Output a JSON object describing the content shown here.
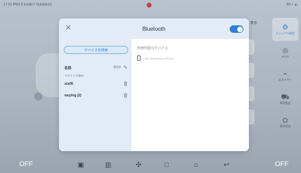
{
  "statusbar": {
    "left": "17:01 PM2.5 Inside7 Outside19",
    "right": "4G • ▲"
  },
  "background": {
    "right_top_text": "表示"
  },
  "side_nav": [
    {
      "label": "ビジュアル設定",
      "icon": "gear-icon",
      "active": true
    },
    {
      "label": "ADAS",
      "icon": "steering-icon",
      "active": false
    },
    {
      "label": "エネルギー",
      "icon": "energy-icon",
      "active": false
    },
    {
      "label": "車両設定",
      "icon": "car-icon",
      "active": false
    },
    {
      "label": "車両状況",
      "icon": "car-status-icon",
      "active": false
    }
  ],
  "bottombar": {
    "left_off": "OFF",
    "right_off": "OFF"
  },
  "modal": {
    "title": "Bluetooth",
    "bluetooth_enabled": true,
    "search_button": "デバイスを検索",
    "name_label": "名前",
    "name_value": "BYD",
    "paired_label": "ペアリング済み",
    "paired_devices": [
      {
        "name": "sts06"
      },
      {
        "name": "wuying (2)"
      }
    ],
    "available_label": "利用可能なデバイス",
    "available_devices": [
      {
        "name": "Mix Nwaaaaaa's iPhone"
      }
    ]
  },
  "colors": {
    "accent": "#2f7fd6",
    "panel_bg": "#e3ecf6"
  }
}
